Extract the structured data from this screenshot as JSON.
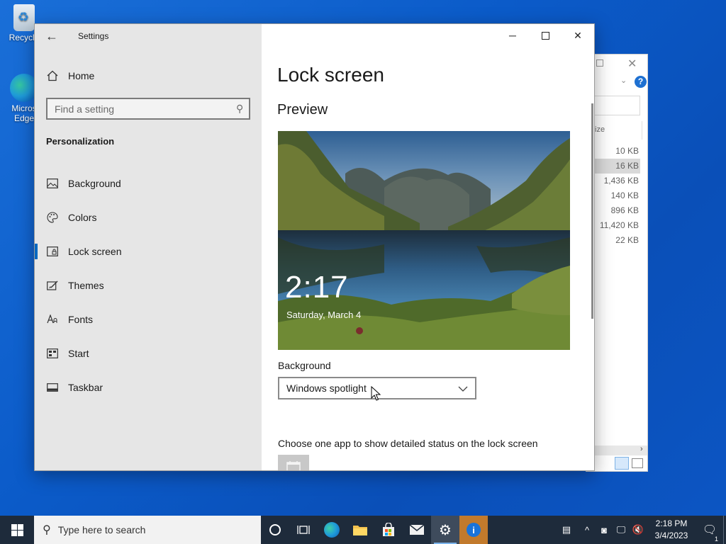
{
  "desktop": {
    "recycle_label": "Recycle",
    "edge_label_line1": "Micros",
    "edge_label_line2": "Edge"
  },
  "explorer": {
    "size_header": "ize",
    "sizes": [
      "10 KB",
      "16 KB",
      "1,436 KB",
      "140 KB",
      "896 KB",
      "11,420 KB",
      "22 KB"
    ],
    "selected_index": 1
  },
  "settings": {
    "app_title": "Settings",
    "home_label": "Home",
    "search_placeholder": "Find a setting",
    "section_title": "Personalization",
    "nav_items": [
      {
        "label": "Background",
        "icon": "picture-icon"
      },
      {
        "label": "Colors",
        "icon": "palette-icon"
      },
      {
        "label": "Lock screen",
        "icon": "lock-screen-icon"
      },
      {
        "label": "Themes",
        "icon": "themes-icon"
      },
      {
        "label": "Fonts",
        "icon": "fonts-icon"
      },
      {
        "label": "Start",
        "icon": "start-icon"
      },
      {
        "label": "Taskbar",
        "icon": "taskbar-icon"
      }
    ],
    "active_item": "Lock screen",
    "page_title": "Lock screen",
    "preview_heading": "Preview",
    "preview_time": "2:17",
    "preview_date": "Saturday, March 4",
    "background_label": "Background",
    "background_value": "Windows spotlight",
    "status_text": "Choose one app to show detailed status on the lock screen"
  },
  "taskbar": {
    "search_placeholder": "Type here to search",
    "time": "2:18 PM",
    "date": "3/4/2023",
    "notification_count": "1"
  }
}
